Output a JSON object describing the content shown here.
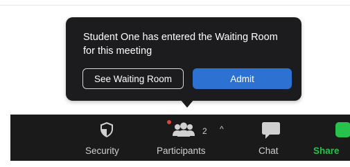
{
  "notification": {
    "message": "Student One has entered the Waiting Room for this meeting",
    "see_waiting_room_label": "See Waiting Room",
    "admit_label": "Admit"
  },
  "toolbar": {
    "security_label": "Security",
    "participants_label": "Participants",
    "participants_count": "2",
    "participants_caret": "^",
    "chat_label": "Chat",
    "share_label": "Share"
  },
  "colors": {
    "popup_bg": "#1c1c1e",
    "admit_blue": "#2d72d3",
    "toolbar_bg": "#1a1a1a",
    "share_green": "#27c24c",
    "alert_red": "#e0433b"
  },
  "icons": {
    "security": "shield-icon",
    "participants": "participants-icon",
    "chat": "chat-bubble-icon",
    "share": "share-screen-icon"
  }
}
